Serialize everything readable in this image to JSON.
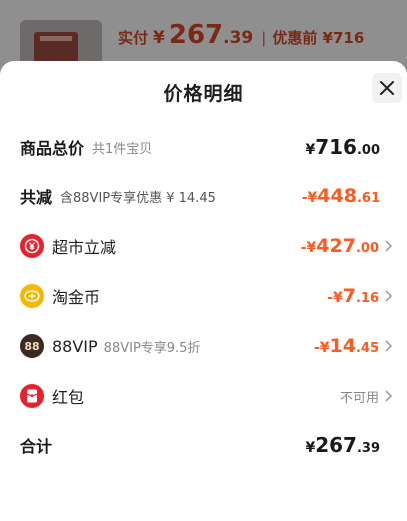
{
  "background_bar": {
    "label": "实付",
    "currency": "¥",
    "price_int": "267",
    "price_dec": ".39",
    "separator": "|",
    "orig_label": "优惠前 ¥716"
  },
  "sheet": {
    "title": "价格明细"
  },
  "rows": {
    "goods_total": {
      "label": "商品总价",
      "sub": "共1件宝贝",
      "currency": "¥",
      "int": "716",
      "dec": ".00"
    },
    "total_discount": {
      "label": "共减",
      "sub": "含88VIP专享优惠 ¥ 14.45",
      "currency": "-¥",
      "int": "448",
      "dec": ".61"
    },
    "supermarket": {
      "label": "超市立减",
      "currency": "-¥",
      "int": "427",
      "dec": ".00"
    },
    "taojinbi": {
      "label": "淘金币",
      "currency": "-¥",
      "int": "7",
      "dec": ".16"
    },
    "vip88": {
      "label": "88VIP",
      "sub": "88VIP专享9.5折",
      "currency": "-¥",
      "int": "14",
      "dec": ".45",
      "icon_text": "88"
    },
    "hongbao": {
      "label": "红包",
      "status": "不可用"
    },
    "total": {
      "label": "合计",
      "currency": "¥",
      "int": "267",
      "dec": ".39"
    }
  },
  "colors": {
    "accent_orange": "#ff5a1f",
    "supermarket_icon": "#e8212a",
    "taojinbi_icon": "#f5b800",
    "vip_icon": "#3a2a24",
    "hongbao_icon": "#e8212a"
  },
  "icons": {
    "close": "close-icon",
    "supermarket": "yuan-coupon-icon",
    "taojinbi": "gold-coin-icon",
    "vip": "vip-88-icon",
    "hongbao": "red-envelope-icon",
    "chevron": "chevron-right-icon"
  }
}
